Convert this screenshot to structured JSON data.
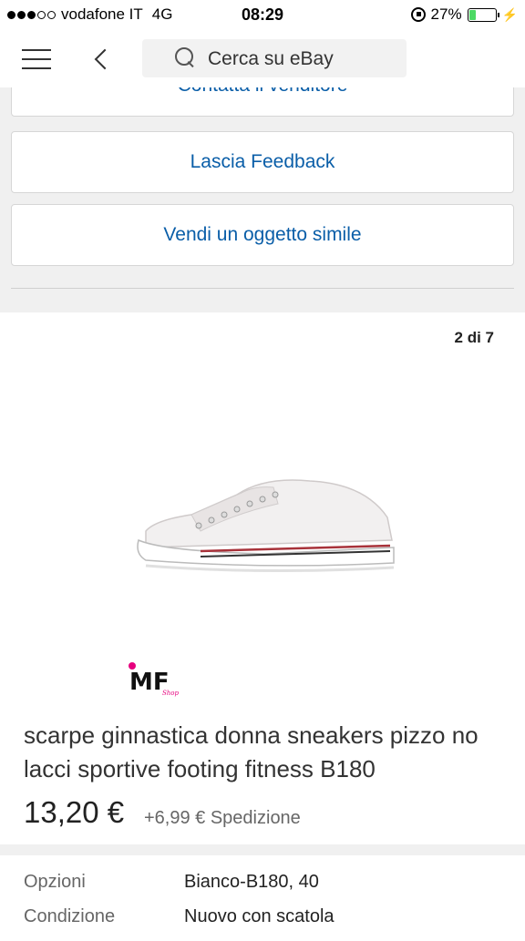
{
  "status_bar": {
    "carrier": "vodafone IT",
    "network": "4G",
    "time": "08:29",
    "battery": "27%",
    "battery_level": 0.27
  },
  "nav": {
    "search_placeholder": "Cerca su eBay"
  },
  "actions": {
    "contact_label": "Contatta il venditore",
    "feedback_label": "Lascia Feedback",
    "sell_similar_label": "Vendi un oggetto simile"
  },
  "gallery": {
    "counter": "2 di 7",
    "logo_text": "MF",
    "logo_sub": "Shop"
  },
  "item": {
    "title": "scarpe ginnastica donna sneakers pizzo no lacci sportive footing fitness B180",
    "price": "13,20 €",
    "shipping": "+6,99 € Spedizione"
  },
  "details": [
    {
      "label": "Opzioni",
      "value": "Bianco-B180, 40"
    },
    {
      "label": "Condizione",
      "value": "Nuovo con scatola"
    }
  ],
  "colors": {
    "link_blue": "#0a5ea8",
    "background_gray": "#f0f0f0",
    "battery_green": "#4cd964"
  }
}
